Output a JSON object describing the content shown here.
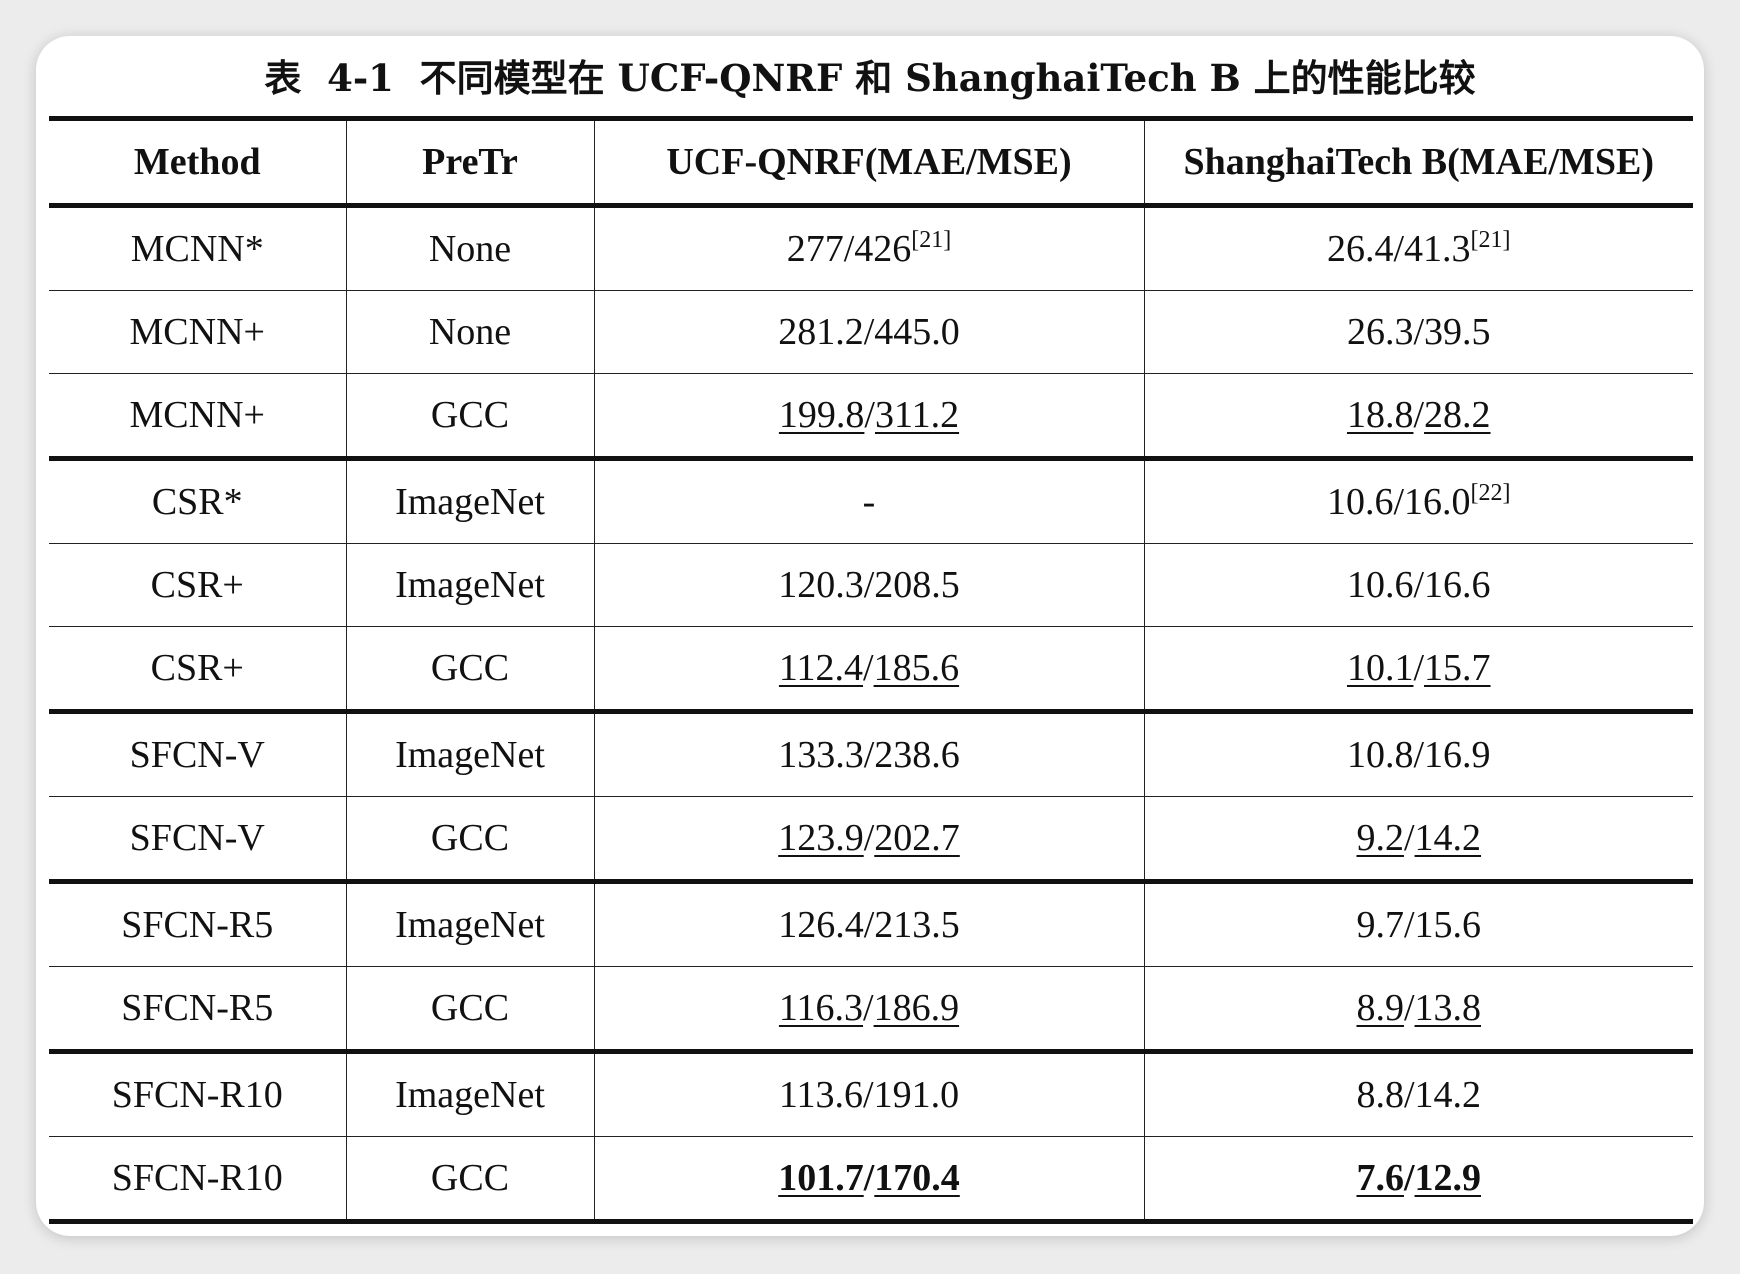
{
  "caption": "表  4-1  不同模型在 UCF-QNRF 和 ShanghaiTech B 上的性能比较",
  "columns": [
    "Method",
    "PreTr",
    "UCF-QNRF(MAE/MSE)",
    "ShanghaiTech B(MAE/MSE)"
  ],
  "rows": [
    {
      "method": "MCNN*",
      "pretr": "None",
      "qnrf_mae": "277",
      "qnrf_mse": "426",
      "qnrf_ref": "[21]",
      "sh_mae": "26.4",
      "sh_mse": "41.3",
      "sh_ref": "[21]",
      "underline": false,
      "bold": false,
      "group_end": false
    },
    {
      "method": "MCNN+",
      "pretr": "None",
      "qnrf_mae": "281.2",
      "qnrf_mse": "445.0",
      "qnrf_ref": "",
      "sh_mae": "26.3",
      "sh_mse": "39.5",
      "sh_ref": "",
      "underline": false,
      "bold": false,
      "group_end": false
    },
    {
      "method": "MCNN+",
      "pretr": "GCC",
      "qnrf_mae": "199.8",
      "qnrf_mse": "311.2",
      "qnrf_ref": "",
      "sh_mae": "18.8",
      "sh_mse": "28.2",
      "sh_ref": "",
      "underline": true,
      "bold": false,
      "group_end": true
    },
    {
      "method": "CSR*",
      "pretr": "ImageNet",
      "qnrf_text": "-",
      "sh_mae": "10.6",
      "sh_mse": "16.0",
      "sh_ref": "[22]",
      "underline": false,
      "bold": false,
      "group_end": false
    },
    {
      "method": "CSR+",
      "pretr": "ImageNet",
      "qnrf_mae": "120.3",
      "qnrf_mse": "208.5",
      "qnrf_ref": "",
      "sh_mae": "10.6",
      "sh_mse": "16.6",
      "sh_ref": "",
      "underline": false,
      "bold": false,
      "group_end": false
    },
    {
      "method": "CSR+",
      "pretr": "GCC",
      "qnrf_mae": "112.4",
      "qnrf_mse": "185.6",
      "qnrf_ref": "",
      "sh_mae": "10.1",
      "sh_mse": "15.7",
      "sh_ref": "",
      "underline": true,
      "bold": false,
      "group_end": true
    },
    {
      "method": "SFCN-V",
      "pretr": "ImageNet",
      "qnrf_mae": "133.3",
      "qnrf_mse": "238.6",
      "qnrf_ref": "",
      "sh_mae": "10.8",
      "sh_mse": "16.9",
      "sh_ref": "",
      "underline": false,
      "bold": false,
      "group_end": false
    },
    {
      "method": "SFCN-V",
      "pretr": "GCC",
      "qnrf_mae": "123.9",
      "qnrf_mse": "202.7",
      "qnrf_ref": "",
      "sh_mae": "9.2",
      "sh_mse": "14.2",
      "sh_ref": "",
      "underline": true,
      "bold": false,
      "group_end": true
    },
    {
      "method": "SFCN-R5",
      "pretr": "ImageNet",
      "qnrf_mae": "126.4",
      "qnrf_mse": "213.5",
      "qnrf_ref": "",
      "sh_mae": "9.7",
      "sh_mse": "15.6",
      "sh_ref": "",
      "underline": false,
      "bold": false,
      "group_end": false
    },
    {
      "method": "SFCN-R5",
      "pretr": "GCC",
      "qnrf_mae": "116.3",
      "qnrf_mse": "186.9",
      "qnrf_ref": "",
      "sh_mae": "8.9",
      "sh_mse": "13.8",
      "sh_ref": "",
      "underline": true,
      "bold": false,
      "group_end": true
    },
    {
      "method": "SFCN-R10",
      "pretr": "ImageNet",
      "qnrf_mae": "113.6",
      "qnrf_mse": "191.0",
      "qnrf_ref": "",
      "sh_mae": "8.8",
      "sh_mse": "14.2",
      "sh_ref": "",
      "underline": false,
      "bold": false,
      "group_end": false
    },
    {
      "method": "SFCN-R10",
      "pretr": "GCC",
      "qnrf_mae": "101.7",
      "qnrf_mse": "170.4",
      "qnrf_ref": "",
      "sh_mae": "7.6",
      "sh_mse": "12.9",
      "sh_ref": "",
      "underline": true,
      "bold": true,
      "group_end": false
    }
  ]
}
